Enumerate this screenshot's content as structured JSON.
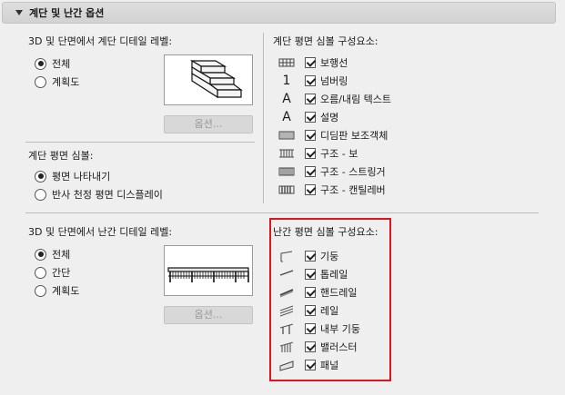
{
  "section": {
    "title": "계단 및 난간 옵션"
  },
  "stair": {
    "detail_label": "3D 및 단면에서 계단 디테일 레벨:",
    "detail_options": [
      {
        "label": "전체",
        "selected": true
      },
      {
        "label": "계획도",
        "selected": false
      }
    ],
    "options_button": "옵션...",
    "plan_label": "계단 평면 심볼:",
    "plan_options": [
      {
        "label": "평면 나타내기",
        "selected": true
      },
      {
        "label": "반사 천정 평면 디스플레이",
        "selected": false
      }
    ],
    "components_label": "계단 평면 심볼 구성요소:",
    "components": [
      {
        "label": "보행선",
        "checked": true,
        "icon": "walking-line-icon"
      },
      {
        "label": "넘버링",
        "checked": true,
        "icon": "numbering-icon"
      },
      {
        "label": "오름/내림 텍스트",
        "checked": true,
        "icon": "text-a-icon"
      },
      {
        "label": "설명",
        "checked": true,
        "icon": "text-a-icon"
      },
      {
        "label": "디딤판 보조객체",
        "checked": true,
        "icon": "tread-accessory-icon"
      },
      {
        "label": "구조 - 보",
        "checked": true,
        "icon": "structure-beam-icon"
      },
      {
        "label": "구조 - 스트링거",
        "checked": true,
        "icon": "structure-stringer-icon"
      },
      {
        "label": "구조 - 캔틸레버",
        "checked": true,
        "icon": "structure-cantilever-icon"
      }
    ]
  },
  "railing": {
    "detail_label": "3D 및 단면에서 난간 디테일 레벨:",
    "detail_options": [
      {
        "label": "전체",
        "selected": true
      },
      {
        "label": "간단",
        "selected": false
      },
      {
        "label": "계획도",
        "selected": false
      }
    ],
    "options_button": "옵션...",
    "components_label": "난간 평면 심볼 구성요소:",
    "components": [
      {
        "label": "기둥",
        "checked": true,
        "icon": "post-icon"
      },
      {
        "label": "톱레일",
        "checked": true,
        "icon": "toprail-icon"
      },
      {
        "label": "핸드레일",
        "checked": true,
        "icon": "handrail-icon"
      },
      {
        "label": "레일",
        "checked": true,
        "icon": "rail-icon"
      },
      {
        "label": "내부 기둥",
        "checked": true,
        "icon": "inner-post-icon"
      },
      {
        "label": "밸러스터",
        "checked": true,
        "icon": "baluster-icon"
      },
      {
        "label": "패널",
        "checked": true,
        "icon": "panel-icon"
      }
    ]
  },
  "colors": {
    "highlight": "#e0141e",
    "background": "#efefef"
  }
}
